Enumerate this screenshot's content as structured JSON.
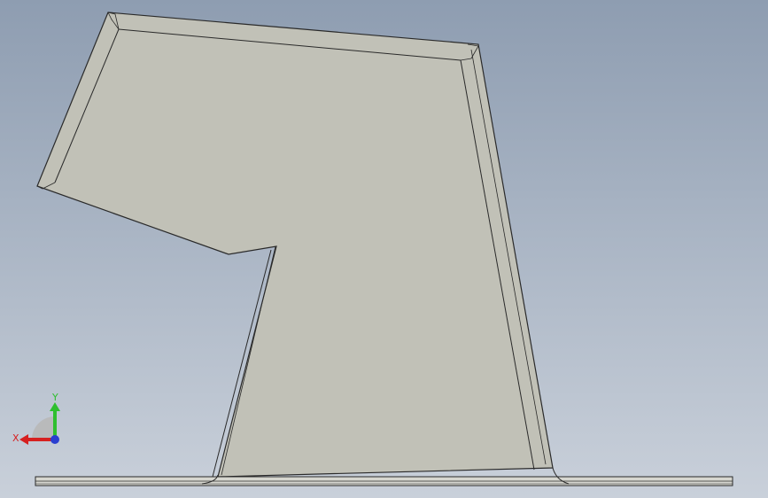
{
  "viewport": {
    "background_top": "#8e9db1",
    "background_bottom": "#c9d0da"
  },
  "part": {
    "face_color": "#c1c1b7",
    "edge_color": "#2a2a2a",
    "flange_color": "#d6d6cf"
  },
  "triad": {
    "x_label": "X",
    "y_label": "Y",
    "x_color": "#d62020",
    "y_color": "#2fbf2f",
    "z_color": "#2a3fd0"
  }
}
